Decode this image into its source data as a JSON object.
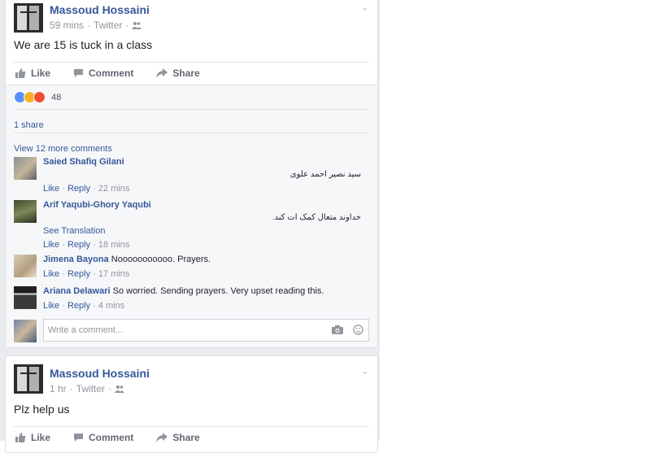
{
  "posts": [
    {
      "author": "Massoud Hossaini",
      "time": "59 mins",
      "source": "Twitter",
      "text": "We are 15 is tuck in a class",
      "actions": {
        "like": "Like",
        "comment": "Comment",
        "share": "Share"
      },
      "reaction_count": "48",
      "shares": "1 share",
      "view_more": "View 12 more comments",
      "comments": [
        {
          "author": "Saied Shafiq Gilani",
          "text": "سید نصیر احمد علوی",
          "like": "Like",
          "reply": "Reply",
          "time": "22 mins"
        },
        {
          "author": "Arif Yaqubi-Ghory Yaqubi",
          "text": "خداوند متعال کمک ات کند.",
          "translate": "See Translation",
          "like": "Like",
          "reply": "Reply",
          "time": "18 mins"
        },
        {
          "author": "Jimena Bayona",
          "text": "Nooooooooooo. Prayers.",
          "like": "Like",
          "reply": "Reply",
          "time": "17 mins"
        },
        {
          "author": "Ariana Delawari",
          "text": "So worried. Sending prayers. Very upset reading this.",
          "like": "Like",
          "reply": "Reply",
          "time": "4 mins"
        }
      ],
      "write_placeholder": "Write a comment..."
    },
    {
      "author": "Massoud Hossaini",
      "time": "1 hr",
      "source": "Twitter",
      "text": "Plz help us",
      "actions": {
        "like": "Like",
        "comment": "Comment",
        "share": "Share"
      }
    }
  ],
  "separator": "·",
  "colors": {
    "link": "#365899",
    "muted": "#90949c",
    "like_reaction": "#5890ff",
    "sad_reaction": "#f7b125",
    "angry_reaction": "#f04f32"
  },
  "icons": [
    "chevron-down-icon",
    "audience-friends-icon",
    "like-thumb-icon",
    "comment-icon",
    "share-arrow-icon",
    "camera-icon",
    "emoji-icon"
  ]
}
